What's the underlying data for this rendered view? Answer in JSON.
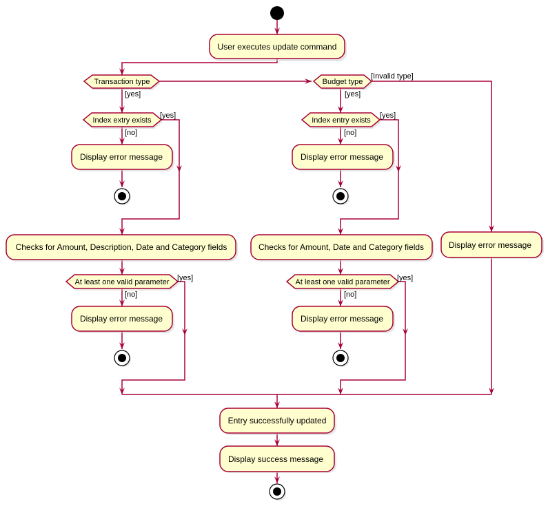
{
  "diagram": {
    "type": "activity",
    "colors": {
      "node_fill": "#FEFECE",
      "node_border": "#A80036",
      "edge": "#A80036",
      "start_end": "#000000"
    },
    "nodes": {
      "user_executes": "User executes update command",
      "transaction_type": "Transaction type",
      "budget_type": "Budget type",
      "t_index_exists": "Index extry exists",
      "b_index_exists": "Index entry exists",
      "t_err1": "Display error message",
      "b_err1": "Display error message",
      "invalid_err": "Display error message",
      "t_checks": "Checks for Amount, Description, Date and Category fields",
      "b_checks": "Checks for Amount, Date and Category fields",
      "t_valid_param": "At least one valid parameter",
      "b_valid_param": "At least one valid parameter",
      "t_err2": "Display error message",
      "b_err2": "Display error message",
      "entry_updated": "Entry successfully updated",
      "success_msg": "Display success message"
    },
    "guards": {
      "transaction_yes": "[yes]",
      "budget_yes": "[yes]",
      "invalid_type": "[Invalid type]",
      "t_index_yes": "[yes]",
      "t_index_no": "[no]",
      "b_index_yes": "[yes]",
      "b_index_no": "[no]",
      "t_param_yes": "[yes]",
      "t_param_no": "[no]",
      "b_param_yes": "[yes]",
      "b_param_no": "[no]"
    }
  }
}
